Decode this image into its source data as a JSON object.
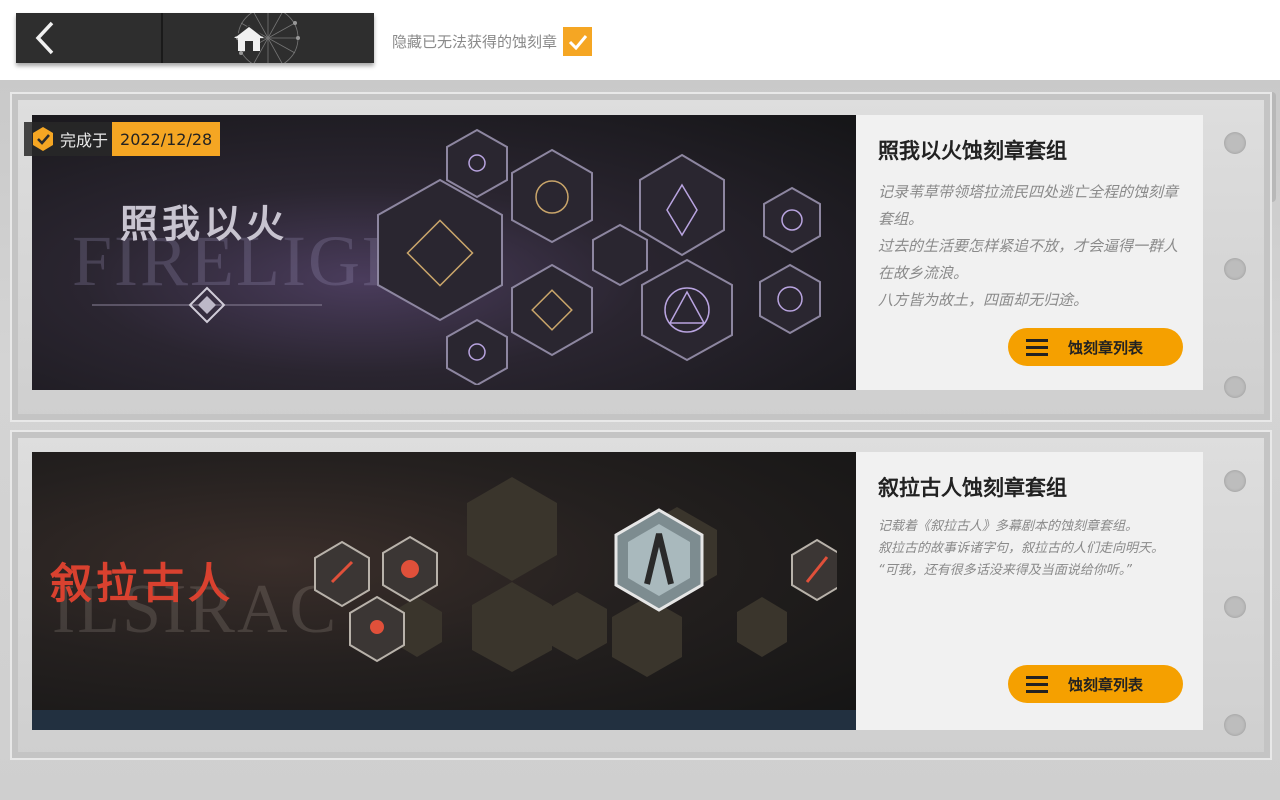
{
  "nav": {
    "back_icon": "chevron-left-icon",
    "home_icon": "home-icon"
  },
  "filter": {
    "hide_unobtainable_label": "隐藏已无法获得的蚀刻章",
    "hide_unobtainable_checked": true
  },
  "colors": {
    "accent": "#f5a623",
    "button": "#f5a000",
    "nav_bg": "#2e2e2e"
  },
  "sets": [
    {
      "banner_title": "照我以火",
      "banner_subtitle": "FIRELIGHT",
      "completed_label": "完成于",
      "completed_date": "2022/12/28",
      "name": "照我以火蚀刻章套组",
      "description": [
        "记录苇草带领塔拉流民四处逃亡全程的蚀刻章套组。",
        "过去的生活要怎样紧追不放，才会逼得一群人在故乡流浪。",
        "八方皆为故土，四面却无归途。"
      ],
      "list_button": "蚀刻章列表"
    },
    {
      "banner_title": "叙拉古人",
      "banner_subtitle": "ILSIRAC",
      "name": "叙拉古人蚀刻章套组",
      "description": [
        "记载着《叙拉古人》多幕剧本的蚀刻章套组。",
        "叙拉古的故事诉诸字句，叙拉古的人们走向明天。",
        "“可我，还有很多话没来得及当面说给你听。”"
      ],
      "list_button": "蚀刻章列表"
    }
  ]
}
